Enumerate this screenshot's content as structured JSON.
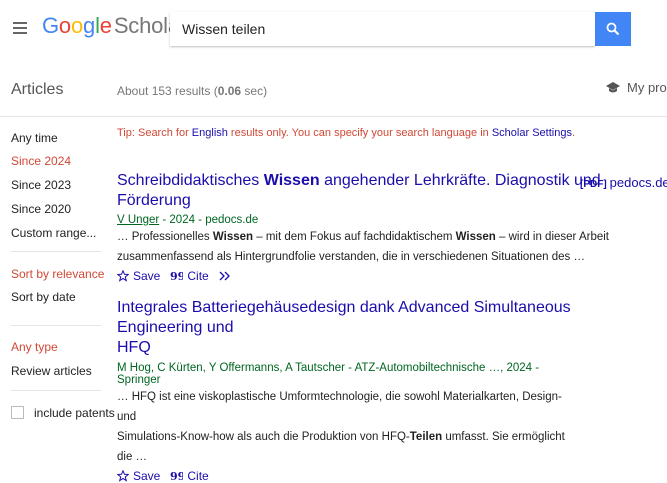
{
  "header": {
    "logo_google": [
      "G",
      "o",
      "o",
      "g",
      "l",
      "e"
    ],
    "logo_scholar": "Scholar",
    "search_value": "Wissen teilen"
  },
  "subbar": {
    "title": "Articles",
    "about_prefix": "About 153 results (",
    "about_time": "0.06",
    "about_suffix": " sec)",
    "my_profile": "My profile"
  },
  "sidebar": {
    "time_filters": [
      "Any time",
      "Since 2024",
      "Since 2023",
      "Since 2020",
      "Custom range..."
    ],
    "active_time": "Since 2024",
    "sort": [
      "Sort by relevance",
      "Sort by date"
    ],
    "active_sort": "Sort by relevance",
    "type": [
      "Any type",
      "Review articles"
    ],
    "active_type": "Any type",
    "patents_label": "include patents"
  },
  "tip": {
    "prefix": "Tip: Search for ",
    "english": "English",
    "middle": " results only. You can specify your search language in ",
    "settings": "Scholar Settings",
    "suffix": "."
  },
  "results": [
    {
      "title_a": "Schreibdidaktisches ",
      "title_b": "Wissen",
      "title_c": " angehender Lehrkräfte. Diagnostik und Förderung",
      "author_link": "V Unger",
      "authors_rest": " - 2024 - pedocs.de",
      "snippet_line1_a": "… Professionelles ",
      "snippet_line1_b": "Wissen",
      "snippet_line1_c": " – mit dem Fokus auf fachdidaktischem ",
      "snippet_line1_d": "Wissen",
      "snippet_line1_e": " – wird in dieser Arbeit",
      "snippet_line2": "zusammenfassend als Hintergrundfolie verstanden, die in verschiedenen Situationen des …",
      "save": "Save",
      "cite": "Cite",
      "pdf_tag": "[PDF]",
      "pdf_source": "pedocs.de"
    },
    {
      "title_a": "Integrales Batteriegehäusedesign dank Advanced Simultaneous Engineering und",
      "title_b": "HFQ",
      "authors": "M Hog, C Kürten, Y Offermanns, A Tautscher - ATZ-Automobiltechnische …, 2024 - Springer",
      "snippet_line1": "… HFQ ist eine viskoplastische Umformtechnologie, die sowohl Materialkarten, Design- und",
      "snippet_line2_a": "Simulations-Know-how als auch die Produktion von HFQ-",
      "snippet_line2_b": "Teilen",
      "snippet_line2_c": " umfasst. Sie ermöglicht die …",
      "save": "Save",
      "cite": "Cite"
    }
  ],
  "colors": {
    "link": "#1a0dab",
    "green": "#006621",
    "red": "#d14836",
    "button": "#4285f4"
  }
}
